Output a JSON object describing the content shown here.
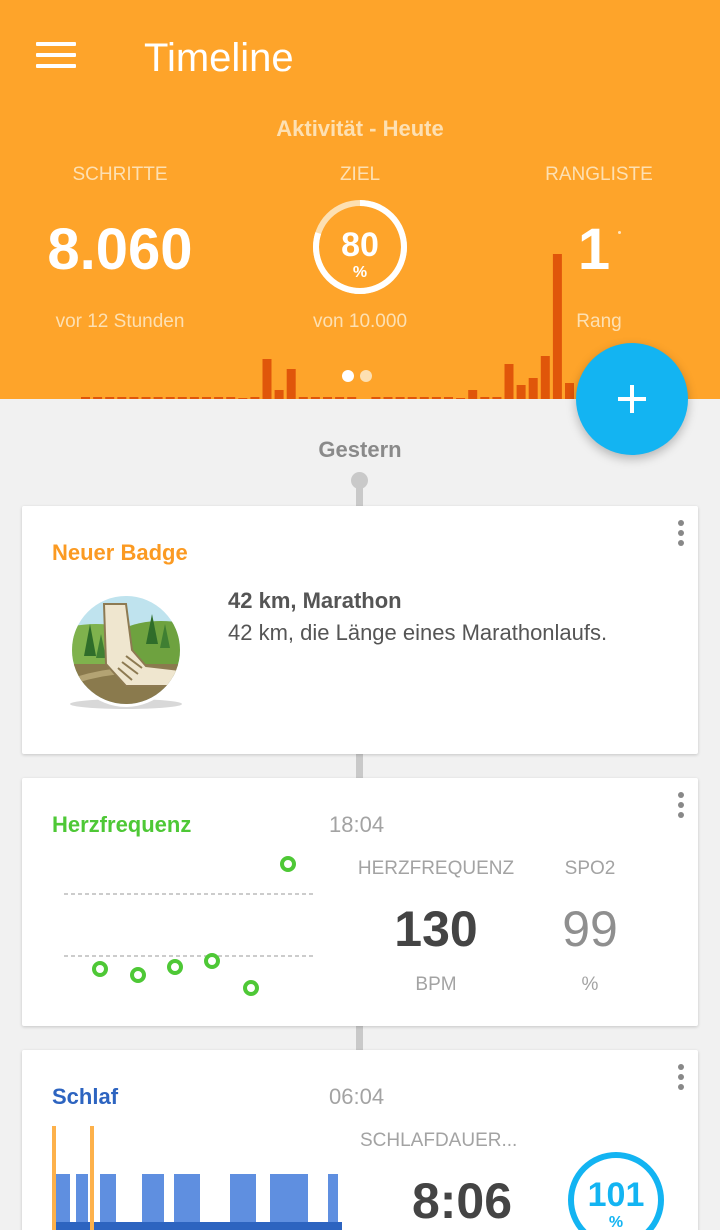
{
  "app": {
    "title": "Timeline"
  },
  "summary": {
    "section_title": "Aktivität - Heute",
    "steps": {
      "label": "SCHRITTE",
      "value": "8.060",
      "sub": "vor 12 Stunden"
    },
    "goal": {
      "label": "ZIEL",
      "value": "80",
      "unit": "%",
      "sub": "von 10.000",
      "progress_fraction": 0.8
    },
    "ranking": {
      "label": "RANGLISTE",
      "value": "1",
      "sub": "Rang"
    },
    "page_indicator": {
      "count": 2,
      "active": 0
    },
    "activity_bars": [
      2,
      2,
      2,
      2,
      2,
      2,
      2,
      2,
      2,
      2,
      2,
      2,
      2,
      1,
      2,
      40,
      9,
      30,
      2,
      2,
      2,
      2,
      2,
      0,
      2,
      2,
      2,
      2,
      2,
      2,
      2,
      1,
      9,
      2,
      2,
      35,
      14,
      21,
      43,
      145,
      16
    ]
  },
  "timeline": {
    "day_label": "Gestern",
    "cards": {
      "badge": {
        "title": "Neuer Badge",
        "name": "42 km, Marathon",
        "description": "42 km, die Länge eines Marathonlaufs.",
        "icon": "marathon-shoe-badge"
      },
      "heart_rate": {
        "title": "Herzfrequenz",
        "time": "18:04",
        "metric1": {
          "label": "HERZFREQUENZ",
          "value": "130",
          "unit": "BPM"
        },
        "metric2": {
          "label": "SPO2",
          "value": "99",
          "unit": "%"
        }
      },
      "sleep": {
        "title": "Schlaf",
        "time": "06:04",
        "metric_label": "SCHLAFDAUER...",
        "metric_value": "8:06",
        "ring_value": "101",
        "ring_unit": "%",
        "ring_fraction": 1.0
      }
    }
  },
  "colors": {
    "header": "#fea42a",
    "fab": "#13b4f2",
    "badge_title": "#fb9a22",
    "heart_title": "#4ec836",
    "sleep_title": "#2d64c0",
    "activity_bar": "#e0560a"
  },
  "icons": {
    "menu": "hamburger-menu-icon",
    "fab": "plus-icon",
    "more": "more-vertical-icon"
  }
}
